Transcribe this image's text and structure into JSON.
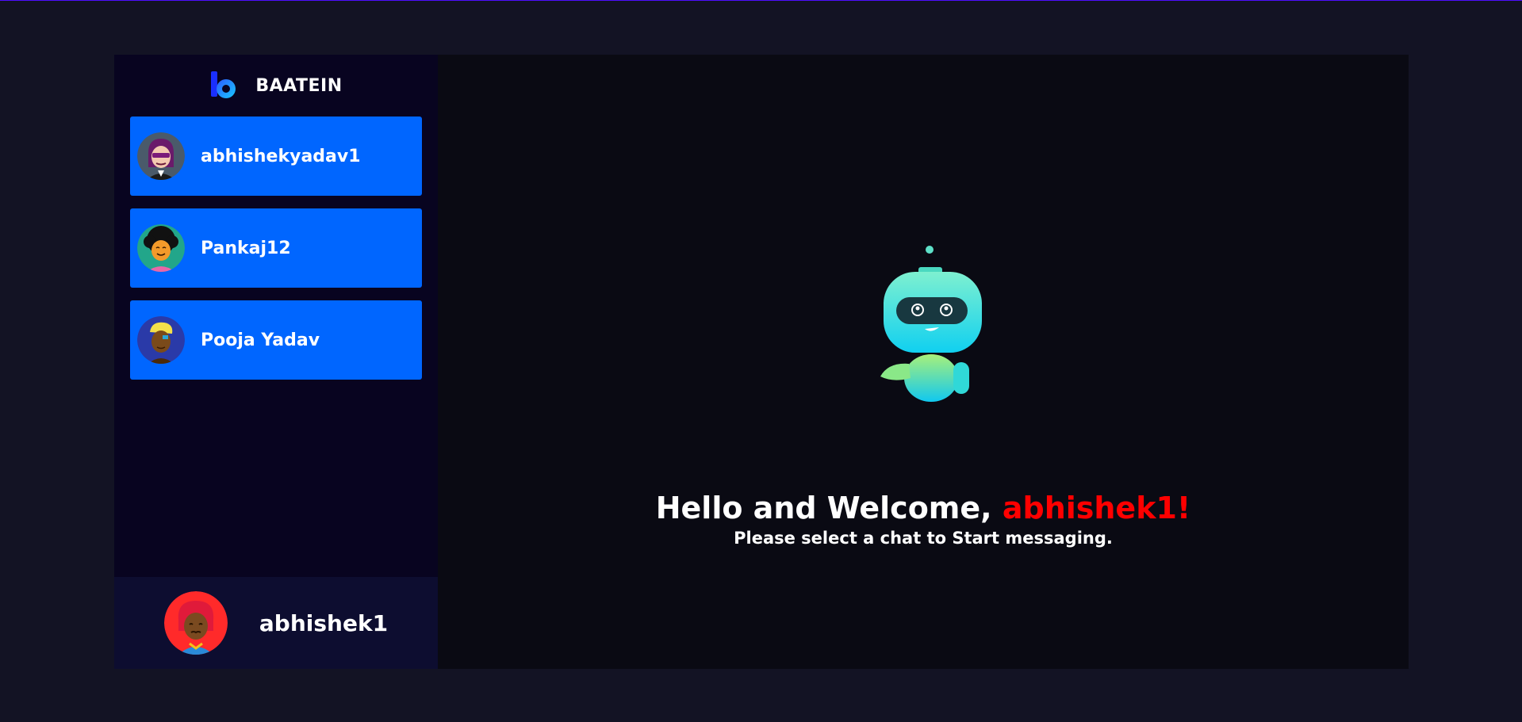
{
  "brand": {
    "name": "BAATEIN",
    "logo_icon": "baatein-logo-icon"
  },
  "contacts": [
    {
      "name": "abhishekyadav1",
      "avatar_icon": "avatar-purple-hair-sunglasses-icon"
    },
    {
      "name": "Pankaj12",
      "avatar_icon": "avatar-curly-hair-icon"
    },
    {
      "name": "Pooja Yadav",
      "avatar_icon": "avatar-blonde-hair-icon"
    }
  ],
  "current_user": {
    "name": "abhishek1",
    "avatar_icon": "avatar-red-hair-icon"
  },
  "welcome": {
    "greeting": "Hello and Welcome, ",
    "username": "abhishek1!",
    "subtitle": "Please select a chat to Start messaging."
  },
  "colors": {
    "accent": "#0066ff",
    "highlight": "#ff0000",
    "sidebar_bg": "#080420",
    "page_bg": "#131324"
  }
}
